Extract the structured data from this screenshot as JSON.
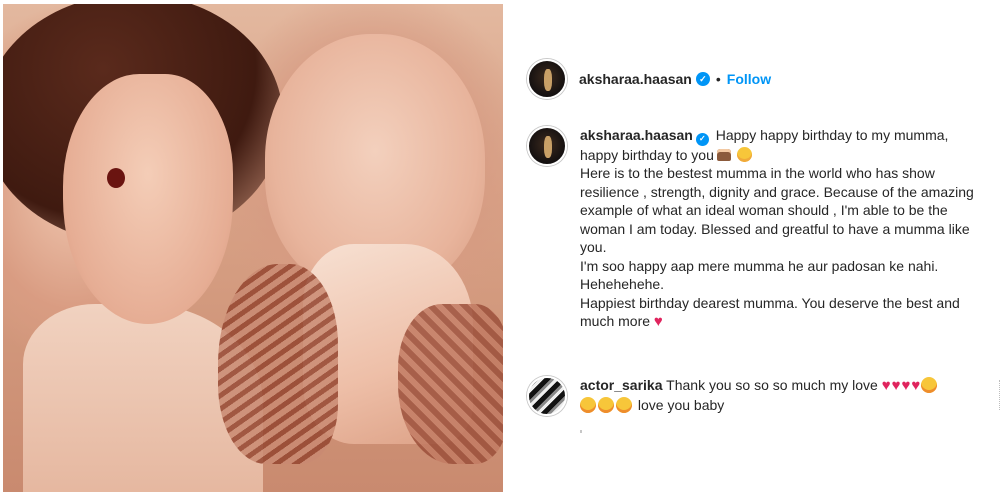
{
  "photo": {
    "alt": "Mother and baby photo"
  },
  "header": {
    "username": "aksharaa.haasan",
    "separator": "•",
    "follow_label": "Follow"
  },
  "caption": {
    "username": "aksharaa.haasan",
    "line1": "Happy happy birthday to my mumma, happy birthday to you",
    "para1": "Here is to the bestest mumma in the world who has show resilience , strength, dignity and grace. Because of the amazing example of what an ideal woman should , I'm able to be the woman I am today. Blessed and greatful to have a mumma like you.",
    "para2": "I'm soo happy aap mere mumma he aur padosan ke nahi. Hehehehehe.",
    "para3": "Happiest birthday dearest mumma. You deserve the best and much more",
    "heart": "♥"
  },
  "comment": {
    "username": "actor_sarika",
    "text": "Thank you so so so much my love",
    "text2": "love you baby",
    "heart": "♥"
  },
  "colors": {
    "accent": "#0095f6",
    "heart": "#e0245e"
  }
}
